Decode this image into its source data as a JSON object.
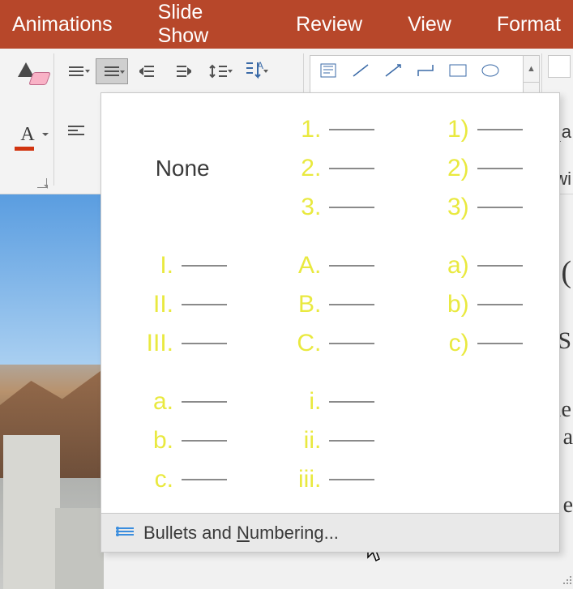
{
  "tabs": {
    "animations": "Animations",
    "slideshow": "Slide Show",
    "review": "Review",
    "view": "View",
    "format": "Format"
  },
  "dropdown": {
    "none": "None",
    "options": [
      {
        "items": [
          "1.",
          "2.",
          "3."
        ]
      },
      {
        "items": [
          "1)",
          "2)",
          "3)"
        ]
      },
      {
        "items": [
          "I.",
          "II.",
          "III."
        ]
      },
      {
        "items": [
          "A.",
          "B.",
          "C."
        ]
      },
      {
        "items": [
          "a)",
          "b)",
          "c)"
        ]
      },
      {
        "items": [
          "a.",
          "b.",
          "c."
        ]
      },
      {
        "items": [
          "i.",
          "ii.",
          "iii."
        ]
      }
    ],
    "menu_pre": "Bullets and ",
    "menu_u": "N",
    "menu_post": "umbering..."
  },
  "rt": {
    "a1": "a",
    "wi": "wi",
    "paren": "(",
    "S": "S",
    "le": "le",
    "a2": "a",
    "e": "e"
  }
}
